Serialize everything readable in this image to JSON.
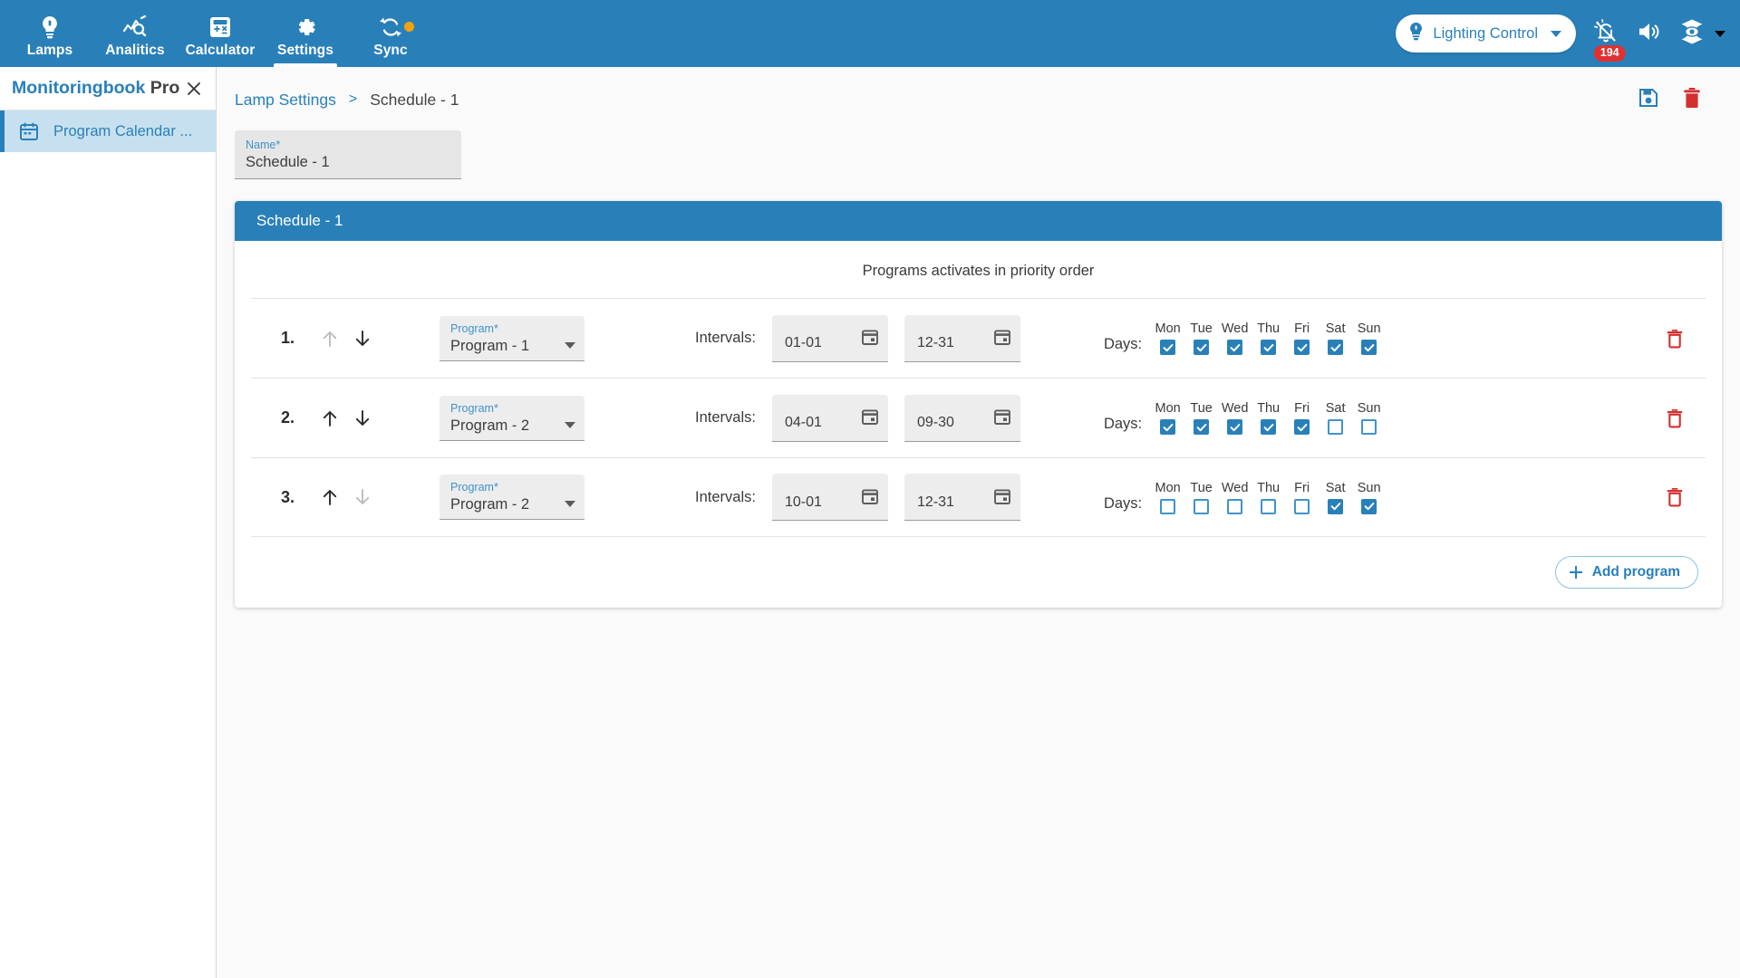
{
  "topbar": {
    "tabs": [
      {
        "label": "Lamps",
        "icon": "lamp-icon",
        "active": false
      },
      {
        "label": "Analitics",
        "icon": "analytics-icon",
        "active": false
      },
      {
        "label": "Calculator",
        "icon": "calculator-icon",
        "active": false
      },
      {
        "label": "Settings",
        "icon": "gear-icon",
        "active": true
      },
      {
        "label": "Sync",
        "icon": "sync-icon",
        "active": false
      }
    ],
    "lighting_control": {
      "label": "Lighting Control",
      "icon": "lightbulb-icon"
    },
    "alarm": {
      "icon": "alarm-off-icon",
      "badge": "194"
    },
    "volume": {
      "icon": "volume-icon"
    },
    "user": {
      "icon": "eye-hex-icon"
    }
  },
  "sidebar": {
    "title_primary": "Monitoringbook",
    "title_secondary": "Pro",
    "close_icon": "close-icon",
    "items": [
      {
        "label": "Program Calendar ...",
        "icon": "calendar-icon"
      }
    ]
  },
  "breadcrumb": {
    "parent": "Lamp Settings",
    "separator": ">",
    "current": "Schedule - 1"
  },
  "page_actions": {
    "save_icon": "save-icon",
    "delete_icon": "trash-icon"
  },
  "name_field": {
    "label": "Name",
    "required_mark": "*",
    "value": "Schedule - 1"
  },
  "card": {
    "header": "Schedule - 1",
    "subtitle": "Programs activates in priority order",
    "intervals_label": "Intervals:",
    "days_label": "Days:",
    "day_names": [
      "Mon",
      "Tue",
      "Wed",
      "Thu",
      "Fri",
      "Sat",
      "Sun"
    ],
    "program_label": "Program",
    "program_required_mark": "*",
    "add_button": "Add program",
    "rows": [
      {
        "index": "1.",
        "up_enabled": false,
        "down_enabled": true,
        "program": "Program - 1",
        "start": "01-01",
        "end": "12-31",
        "days": [
          true,
          true,
          true,
          true,
          true,
          true,
          true
        ]
      },
      {
        "index": "2.",
        "up_enabled": true,
        "down_enabled": true,
        "program": "Program - 2",
        "start": "04-01",
        "end": "09-30",
        "days": [
          true,
          true,
          true,
          true,
          true,
          false,
          false
        ]
      },
      {
        "index": "3.",
        "up_enabled": true,
        "down_enabled": false,
        "program": "Program - 2",
        "start": "10-01",
        "end": "12-31",
        "days": [
          false,
          false,
          false,
          false,
          false,
          true,
          true
        ]
      }
    ]
  },
  "colors": {
    "brand": "#2980b9",
    "danger": "#d32f2f",
    "accent_orange": "#f0a30a",
    "badge_red": "#e03131"
  }
}
